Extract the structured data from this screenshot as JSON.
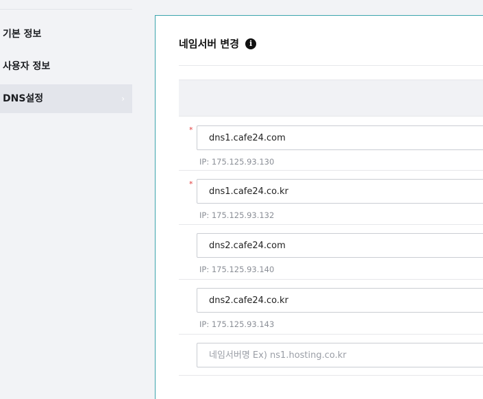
{
  "sidebar": {
    "items": [
      {
        "label": "기본 정보",
        "active": false
      },
      {
        "label": "사용자 정보",
        "active": false
      },
      {
        "label": "DNS설정",
        "active": true,
        "chevron": "›"
      }
    ]
  },
  "panel": {
    "title": "네임서버 변경",
    "info_icon": "i"
  },
  "nameservers": [
    {
      "value": "dns1.cafe24.com",
      "ip": "IP: 175.125.93.130",
      "required": true,
      "star": "*"
    },
    {
      "value": "dns1.cafe24.co.kr",
      "ip": "IP: 175.125.93.132",
      "required": true,
      "star": "*"
    },
    {
      "value": "dns2.cafe24.com",
      "ip": "IP: 175.125.93.140",
      "required": false
    },
    {
      "value": "dns2.cafe24.co.kr",
      "ip": "IP: 175.125.93.143",
      "required": false
    },
    {
      "value": "",
      "placeholder": "네임서버명 Ex) ns1.hosting.co.kr",
      "required": false
    }
  ],
  "colors": {
    "accent_border": "#3aa3ac",
    "required_star": "#e03a3a"
  }
}
